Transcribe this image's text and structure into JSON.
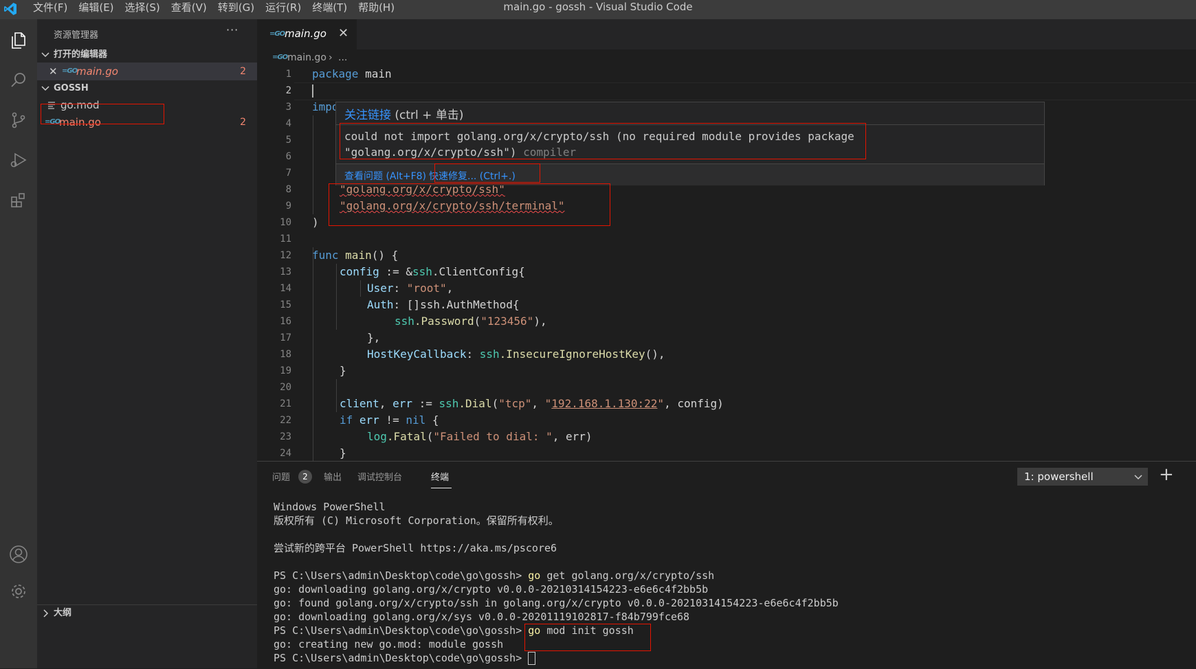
{
  "window": {
    "title": "main.go - gossh - Visual Studio Code"
  },
  "menu": [
    "文件(F)",
    "编辑(E)",
    "选择(S)",
    "查看(V)",
    "转到(G)",
    "运行(R)",
    "终端(T)",
    "帮助(H)"
  ],
  "sidebar": {
    "title": "资源管理器",
    "more": "···",
    "open_editors": {
      "label": "打开的编辑器",
      "items": [
        {
          "name": "main.go",
          "problems": "2"
        }
      ]
    },
    "workspace": {
      "label": "GOSSH",
      "files": [
        {
          "name": "go.mod"
        },
        {
          "name": "main.go",
          "problems": "2"
        }
      ]
    },
    "outline": {
      "label": "大纲"
    }
  },
  "tab": {
    "label": "main.go",
    "close": "✕"
  },
  "breadcrumb": {
    "file": "main.go",
    "sep": "›",
    "rest": "..."
  },
  "editor": {
    "line_numbers": [
      "1",
      "2",
      "3",
      "4",
      "5",
      "6",
      "7",
      "8",
      "9",
      "10",
      "11",
      "12",
      "13",
      "14",
      "15",
      "16",
      "17",
      "18",
      "19",
      "20",
      "21",
      "22",
      "23",
      "24"
    ],
    "lines": {
      "l1": {
        "kw": "package",
        "rest": " main"
      },
      "l3": "impo",
      "l8": "\"golang.org/x/crypto/ssh\"",
      "l9": "\"golang.org/x/crypto/ssh/terminal\"",
      "l10": ")",
      "l12": {
        "kw": "func",
        "name": "main",
        "rest": "() {"
      },
      "l13": {
        "var": "config",
        "op": " := &",
        "pkg": "ssh",
        "rest": ".ClientConfig{"
      },
      "l14": {
        "key": "User",
        "sep": ": ",
        "str": "\"root\"",
        "end": ","
      },
      "l15": {
        "key": "Auth",
        "rest": ": []ssh.AuthMethod{"
      },
      "l16": {
        "pkg": "ssh",
        "fn": ".Password",
        "open": "(",
        "str": "\"123456\"",
        "end": "),"
      },
      "l17": "},",
      "l18": {
        "key": "HostKeyCallback",
        "sep": ": ",
        "pkg": "ssh",
        "fn": ".InsecureIgnoreHostKey",
        "end": "(),"
      },
      "l19": "}",
      "l21": {
        "v1": "client",
        "comma": ", ",
        "v2": "err",
        "op": " := ",
        "pkg": "ssh",
        "fn": ".Dial",
        "open": "(",
        "s1": "\"tcp\"",
        "c2": ", ",
        "s2q1": "\"",
        "s2": "192.168.1.130:22",
        "s2q2": "\"",
        "end": ", config)"
      },
      "l22": {
        "kw": "if",
        "var": " err",
        "op": " != ",
        "kw2": "nil",
        "end": " {"
      },
      "l23": {
        "pkg": "log",
        "fn": ".Fatal",
        "open": "(",
        "str": "\"Failed to dial: \"",
        "end": ", err)"
      },
      "l24": "}"
    }
  },
  "hover": {
    "link": "关注链接",
    "hint": " (ctrl + 单击)",
    "message_line1": "could not import golang.org/x/crypto/ssh (no required module provides package",
    "message_line2": "\"golang.org/x/crypto/ssh\")",
    "source": " compiler",
    "view_problem": "查看问题 (Alt+F8)",
    "quick_fix": "快速修复... (Ctrl+.)"
  },
  "panel": {
    "tabs": [
      {
        "label": "问题",
        "badge": "2"
      },
      {
        "label": "输出"
      },
      {
        "label": "调试控制台"
      },
      {
        "label": "终端"
      }
    ],
    "terminal_select": "1: powershell",
    "add": "+"
  },
  "terminal": {
    "lines": [
      "Windows PowerShell",
      "版权所有 (C) Microsoft Corporation。保留所有权利。",
      "",
      "尝试新的跨平台 PowerShell https://aka.ms/pscore6",
      ""
    ],
    "prompt": "PS C:\\Users\\admin\\Desktop\\code\\go\\gossh> ",
    "cmd1_go": "go",
    "cmd1_rest": " get golang.org/x/crypto/ssh",
    "out1": "go: downloading golang.org/x/crypto v0.0.0-20210314154223-e6e6c4f2bb5b",
    "out2": "go: found golang.org/x/crypto/ssh in golang.org/x/crypto v0.0.0-20210314154223-e6e6c4f2bb5b",
    "out3": "go: downloading golang.org/x/sys v0.0.0-20201119102817-f84b799fce68",
    "cmd2_go": "go",
    "cmd2_rest": " mod init gossh",
    "out4": "go: creating new go.mod: module gossh"
  }
}
